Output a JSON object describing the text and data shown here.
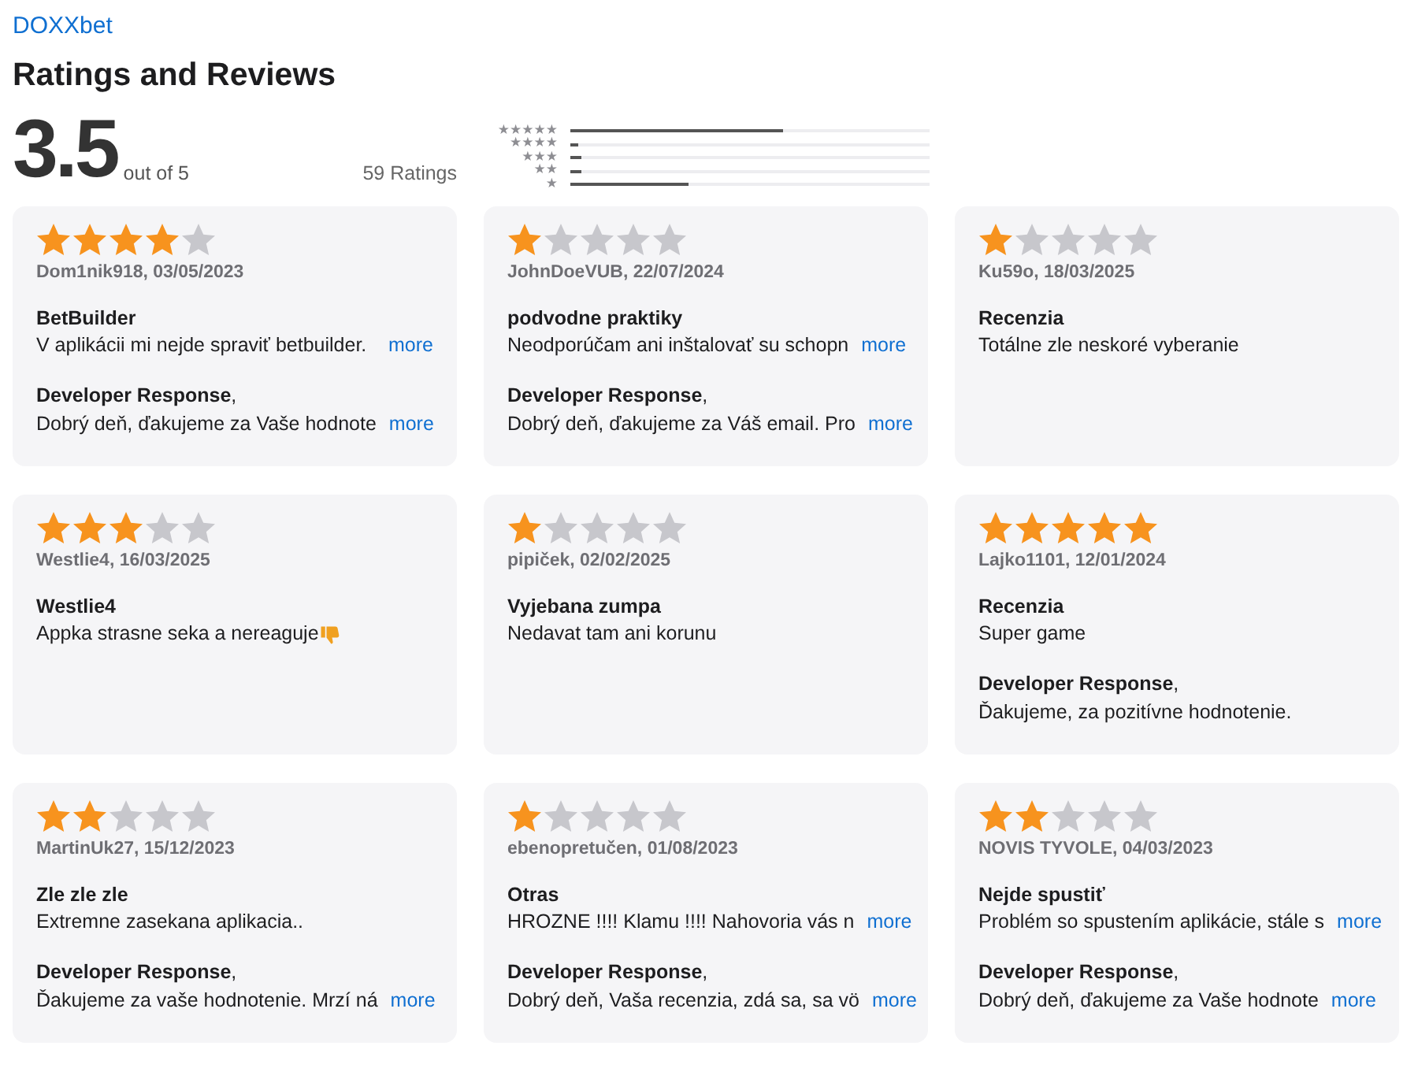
{
  "app_name": "DOXXbet",
  "heading": "Ratings and Reviews",
  "summary": {
    "average": "3.5",
    "out_of": "out of 5",
    "count": "59 Ratings"
  },
  "histogram": [
    {
      "label": "★★★★★",
      "level": 0.59
    },
    {
      "label": "★★★★",
      "level": 0.02
    },
    {
      "label": "★★★",
      "level": 0.03
    },
    {
      "label": "★★",
      "level": 0.03
    },
    {
      "label": "★",
      "level": 0.33
    }
  ],
  "reviews": [
    {
      "stars": 4,
      "byline": "Dom1nik918, 03/05/2023",
      "title": "BetBuilder",
      "body": "V aplikácii mi nejde spraviť betbuilder.",
      "body_more": "more",
      "response": {
        "label": "**Developer Response**,",
        "text": "Dobrý deň, ďakujeme za Vaše hodnote",
        "more": "more"
      }
    },
    {
      "stars": 1,
      "byline": "JohnDoeVUB, 22/07/2024",
      "title": "podvodne praktiky",
      "body": "Neodporúčam ani inštalovať su schopn",
      "body_more": "more",
      "response": {
        "label": "**Developer Response**,",
        "text": "Dobrý deň, ďakujeme za Váš email. Pro",
        "more": "more"
      }
    },
    {
      "stars": 1,
      "byline": "Ku59o, 18/03/2025",
      "title": "Recenzia",
      "body": "Totálne zle neskoré vyberanie"
    },
    {
      "stars": 3,
      "byline": "Westlie4, 16/03/2025",
      "title": "Westlie4",
      "body": "Appka strasne seka a nereaguje",
      "thumbs_down": true
    },
    {
      "stars": 1,
      "byline": "pipiček, 02/02/2025",
      "title": "Vyjebana zumpa",
      "body": "Nedavat tam ani korunu"
    },
    {
      "stars": 5,
      "byline": "Lajko1101, 12/01/2024",
      "title": "Recenzia",
      "body": "Super game",
      "response": {
        "label": "**Developer Response**,",
        "text": "Ďakujeme, za pozitívne hodnotenie."
      }
    },
    {
      "stars": 2,
      "byline": "MartinUk27, 15/12/2023",
      "title": "Zle zle zle",
      "body": "Extremne zasekana aplikacia..",
      "response": {
        "label": "**Developer Response**,",
        "text": "Ďakujeme za vaše hodnotenie. Mrzí ná",
        "more": "more"
      }
    },
    {
      "stars": 1,
      "byline": "ebenopretučen, 01/08/2023",
      "title": "Otras",
      "body": "HROZNE !!!! Klamu !!!! Nahovoria vás n",
      "body_more": "more",
      "response": {
        "label": "**Developer Response**,",
        "text": "Dobrý deň, Vaša recenzia, zdá sa, sa vö",
        "more": "more"
      }
    },
    {
      "stars": 2,
      "byline": "NOVIS TYVOLE, 04/03/2023",
      "title": "Nejde spustiť",
      "body": "Problém so spustením aplikácie, stále s",
      "body_more": "more",
      "response": {
        "label": "**Developer Response**,",
        "text": "Dobrý deň, ďakujeme za Vaše hodnote",
        "more": "more"
      }
    }
  ]
}
